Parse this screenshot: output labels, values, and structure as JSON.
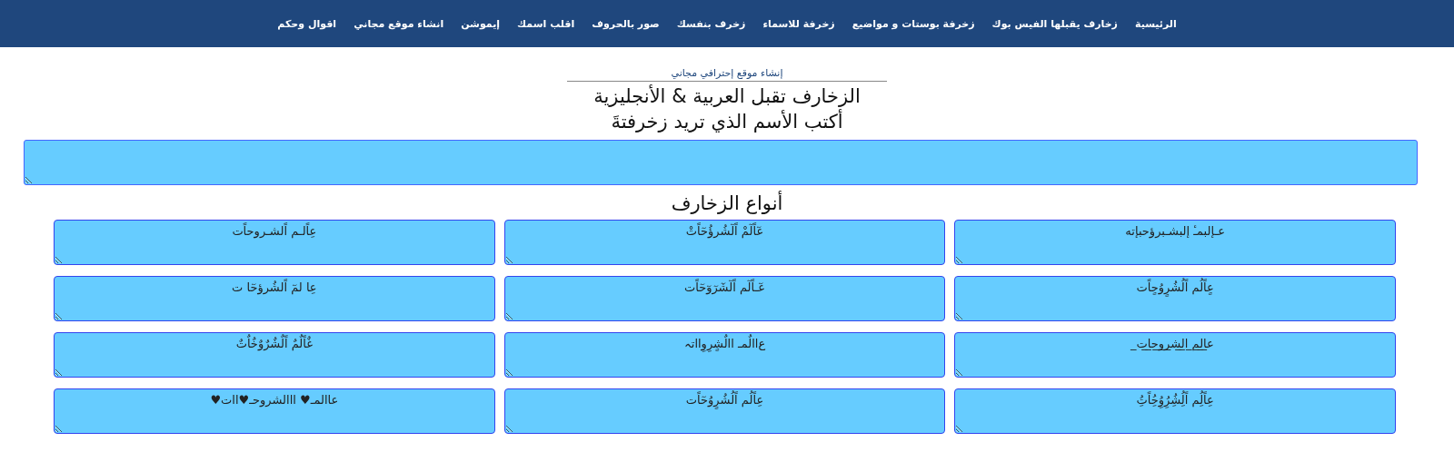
{
  "nav": [
    {
      "label": "الرئيسية"
    },
    {
      "label": "زخارف يقبلها الفيس بوك"
    },
    {
      "label": "زخرفة بوستات و مواضيع"
    },
    {
      "label": "زخرفة للاسماء"
    },
    {
      "label": "زخرف بنفسك"
    },
    {
      "label": "صور بالحروف"
    },
    {
      "label": "اقلب اسمك"
    },
    {
      "label": "إيموشن"
    },
    {
      "label": "انشاء موقع مجاني"
    },
    {
      "label": "اقوال وحكم"
    }
  ],
  "promo_link": "إنشاء موقع إحترافي مجاني",
  "title": "الزخارف تقبل العربية & الأنجليزية",
  "subtitle": "أكتب الأسم الذي تريد زخرفتةَ",
  "section_title": "أنواع الزخارف",
  "outputs": [
    {
      "value": "عـإلبمـٔ إلبشـبرؤحبإته"
    },
    {
      "value": "عٓاًلٓمْ اًلٓشُرؤُحٓاًتْ"
    },
    {
      "value": "عِاًلـم اًلشـروحاًت"
    },
    {
      "value": "عٍاًلُم اًلُشُرٍوُحٍاًت"
    },
    {
      "value": "عٓـاًلٓم اًلٓشٓرٓوٓحٓاًت"
    },
    {
      "value": "عِا لمٓ اًلشُرؤحٓا ت"
    },
    {
      "value": "ع̲ا̲ل̲م̲ ا̲ل̲ش̲ر̲و̲ح̲ا̲ت̲"
    },
    {
      "value": "ﻉاالٌمـ االٌشٍرِوِااتہ"
    },
    {
      "value": "غٌاًلٌمٌ اًلٌشٌرٌوٌخٌاٌتٌ"
    },
    {
      "value": "عِاًلُِم اًلُِشُِرُِوُِحُِاًتُِ"
    },
    {
      "value": "عِاًلُم اًلُشُرٍوُحٓاًت"
    },
    {
      "value": "عاالمـ♥ ااالشروحـ♥اات♥"
    }
  ]
}
